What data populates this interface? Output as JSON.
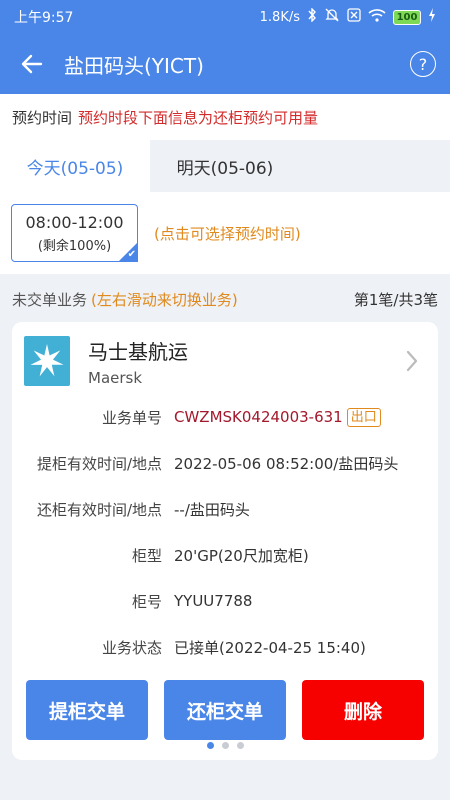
{
  "status_bar": {
    "time": "上午9:57",
    "net_speed": "1.8K/s",
    "battery": "100",
    "icons": [
      "bluetooth-icon",
      "mute-icon",
      "sim-off-icon",
      "wifi-icon",
      "battery-icon",
      "charging-icon"
    ]
  },
  "app_bar": {
    "title": "盐田码头(YICT)",
    "back_icon": "arrow-left-icon",
    "help_icon": "question-circle-icon",
    "help_glyph": "?"
  },
  "notice": {
    "label": "预约时间",
    "warning": "预约时段下面信息为还柜预约可用量",
    "warning_color": "#d32b2b"
  },
  "day_tabs": [
    {
      "label": "今天(05-05)",
      "active": true
    },
    {
      "label": "明天(05-06)",
      "active": false
    }
  ],
  "slot": {
    "time": "08:00-12:00",
    "remaining": "(剩余100%)",
    "selected": true,
    "hint": "(点击可选择预约时间)"
  },
  "business": {
    "header_label": "未交单业务",
    "header_hint": "(左右滑动来切换业务)",
    "pager": "第1笔/共3笔"
  },
  "card": {
    "company_name": "马士基航运",
    "company_sub": "Maersk",
    "logo_icon": "maersk-star-icon",
    "rows": [
      {
        "key": "业务单号",
        "value": "CWZMSK0424003-631",
        "badge": "出口"
      },
      {
        "key": "提柜有效时间/地点",
        "value": "2022-05-06 08:52:00/盐田码头"
      },
      {
        "key": "还柜有效时间/地点",
        "value": "--/盐田码头"
      },
      {
        "key": "柜型",
        "value": "20'GP(20尺加宽柜)"
      },
      {
        "key": "柜号",
        "value": "YYUU7788"
      },
      {
        "key": "业务状态",
        "value": "已接单(2022-04-25 15:40)"
      }
    ],
    "buttons": {
      "pickup": "提柜交单",
      "return": "还柜交单",
      "delete": "删除"
    },
    "page_dots": {
      "count": 3,
      "active": 1
    }
  },
  "colors": {
    "primary": "#4a86e8",
    "accent_orange": "#e08a1e",
    "danger": "#f70000",
    "order_no": "#a3182b"
  }
}
